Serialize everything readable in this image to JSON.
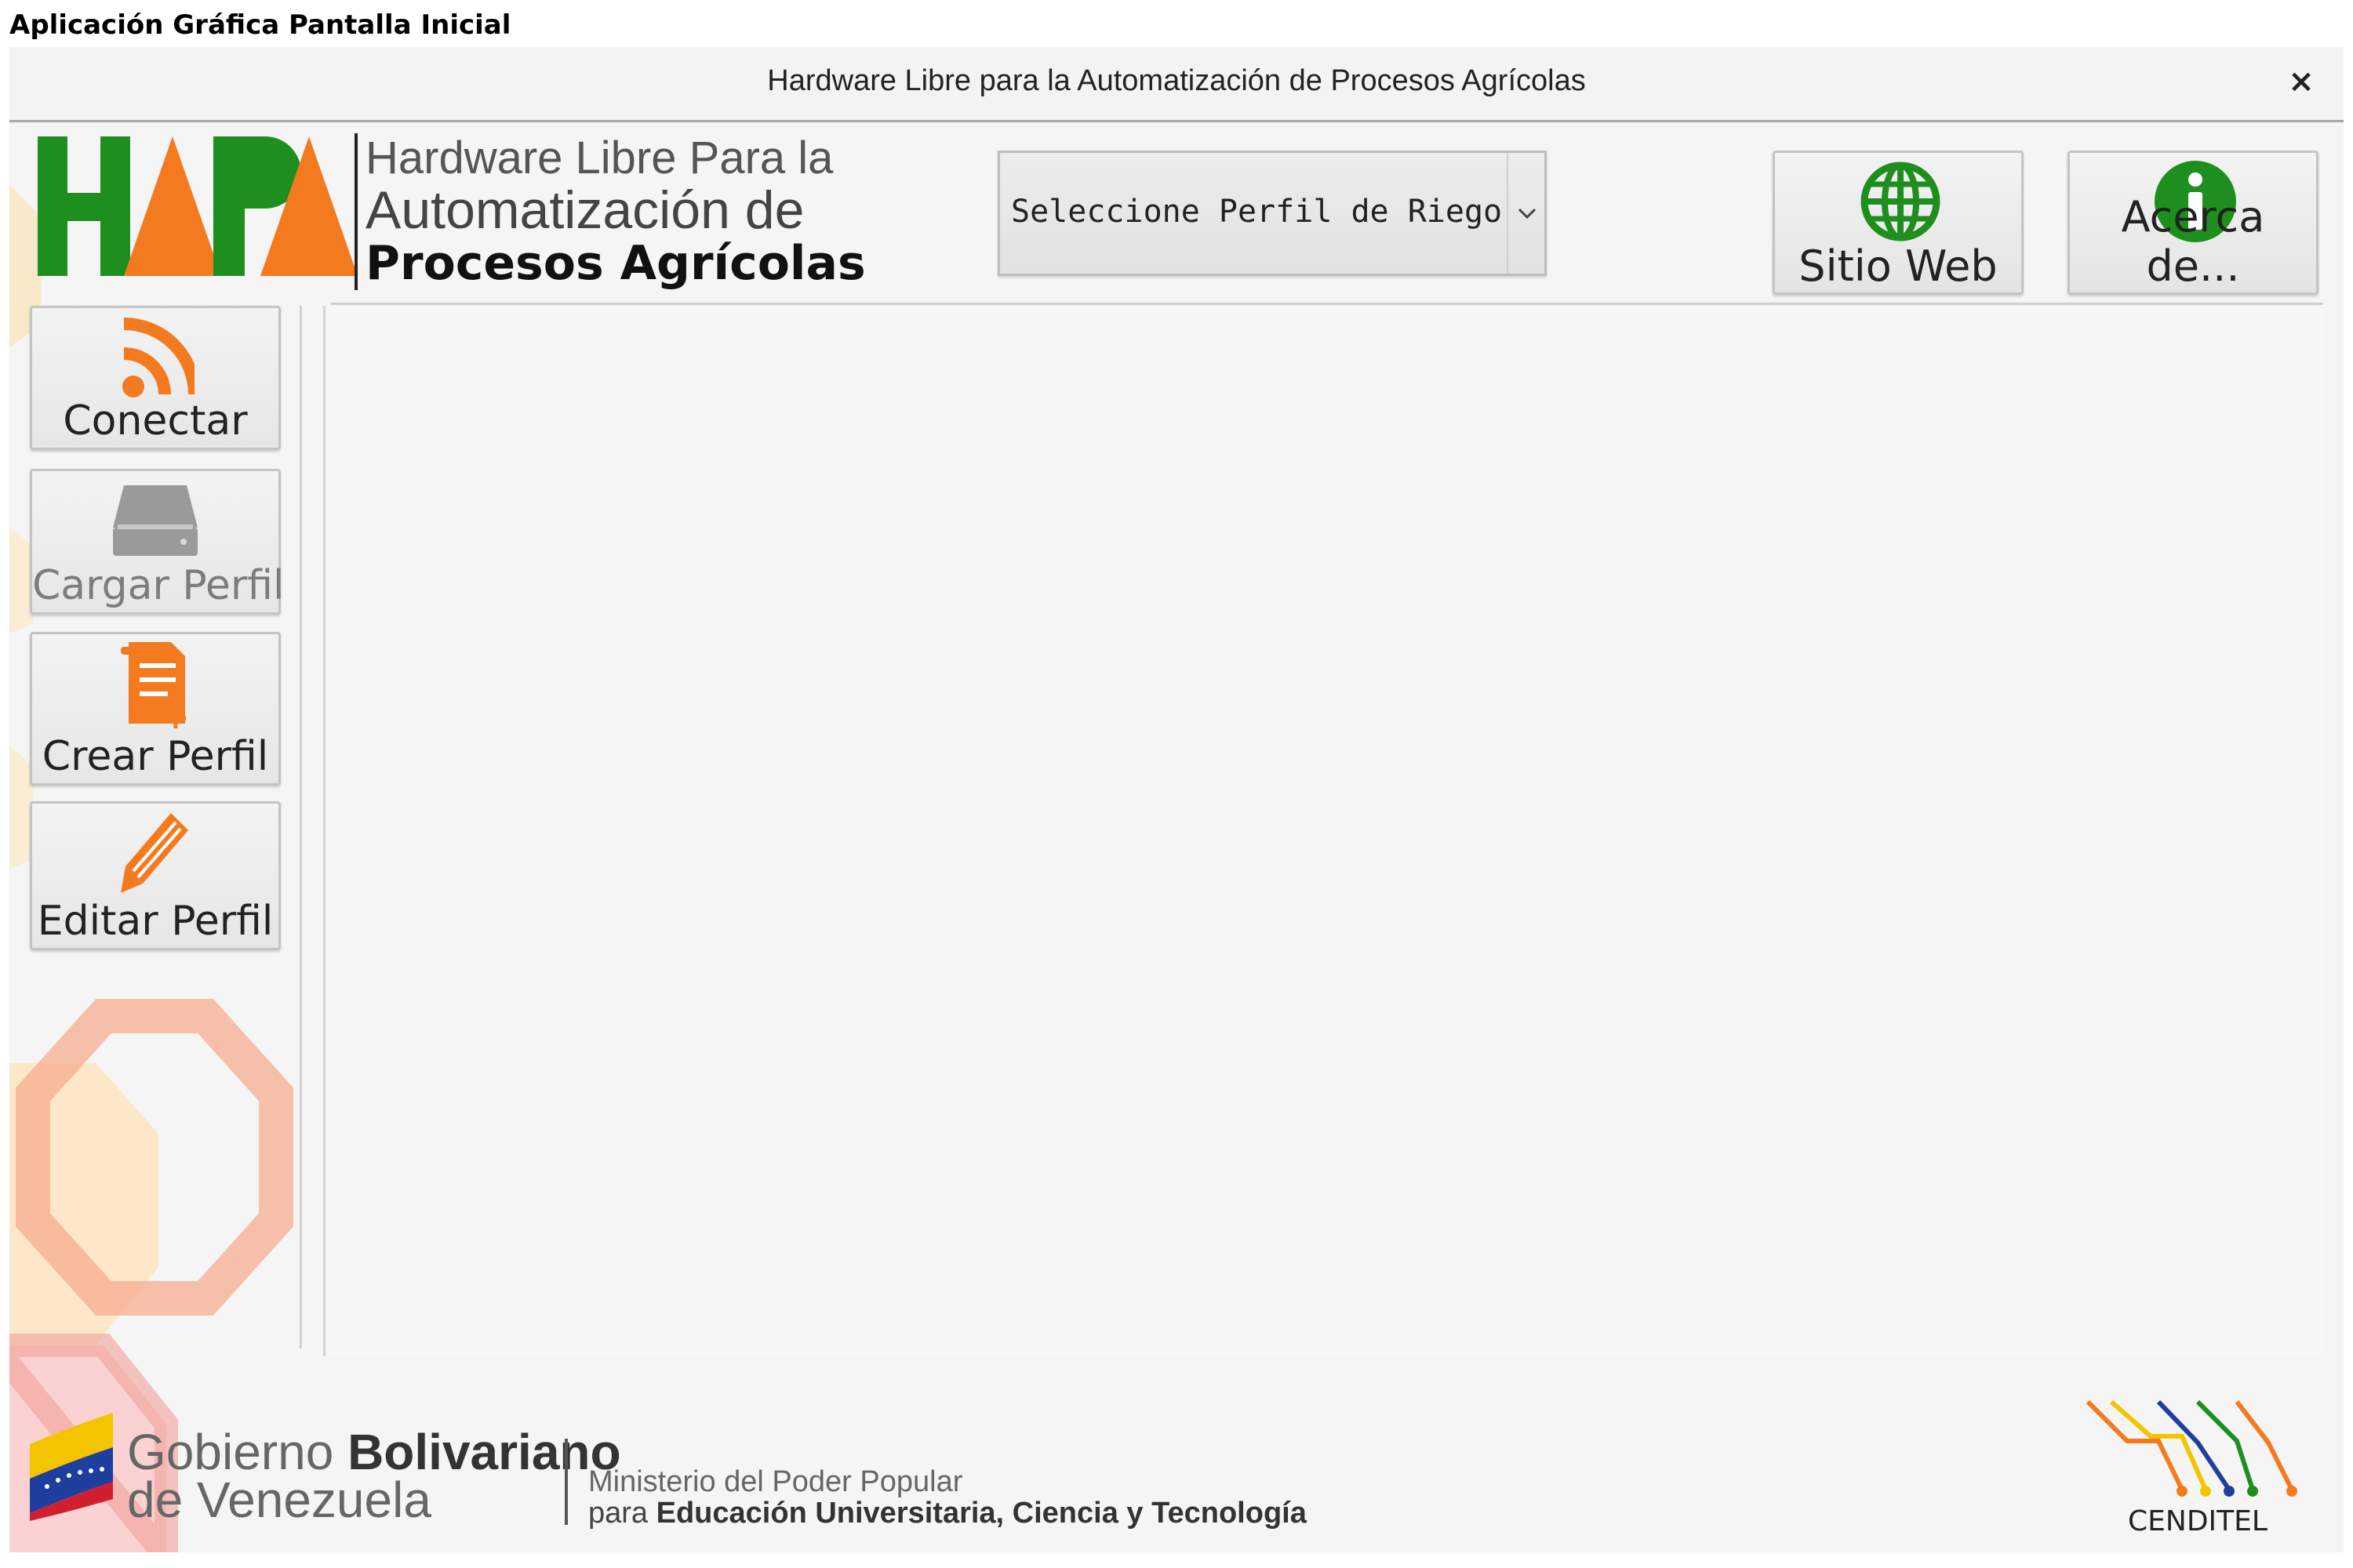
{
  "page": {
    "caption": "Aplicación Gráfica Pantalla Inicial"
  },
  "window": {
    "title": "Hardware Libre para la Automatización de Procesos Agrícolas",
    "close_glyph": "×"
  },
  "logo": {
    "letters": "HAPA",
    "line1": "Hardware Libre Para la",
    "line2": "Automatización de",
    "line3": "Procesos Agrícolas",
    "colors": {
      "green": "#1e8f1e",
      "orange": "#f47a1f"
    }
  },
  "profile_select": {
    "value": "Seleccione Perfil de Riego",
    "icon": "chevron-down-icon"
  },
  "toolbar": {
    "website": {
      "label": "Sitio Web",
      "icon": "globe-icon",
      "color": "#1e8f1e"
    },
    "about": {
      "label": "Acerca de...",
      "icon": "info-icon",
      "color": "#1e8f1e"
    }
  },
  "sidebar": {
    "connect": {
      "label": "Conectar",
      "icon": "rss-icon",
      "enabled": true
    },
    "load": {
      "label": "Cargar Perfil",
      "icon": "drive-icon",
      "enabled": false
    },
    "create": {
      "label": "Crear Perfil",
      "icon": "new-document-icon",
      "enabled": true
    },
    "edit": {
      "label": "Editar Perfil",
      "icon": "pencil-icon",
      "enabled": true
    }
  },
  "footer": {
    "gobierno_light": "Gobierno ",
    "gobierno_bold": "Bolivariano",
    "gobierno_line2": "de Venezuela",
    "ministry_line1": "Ministerio del Poder Popular",
    "ministry_prefix": "para ",
    "ministry_bold": "Educación Universitaria, Ciencia y Tecnología",
    "cenditel": "CENDITEL"
  }
}
